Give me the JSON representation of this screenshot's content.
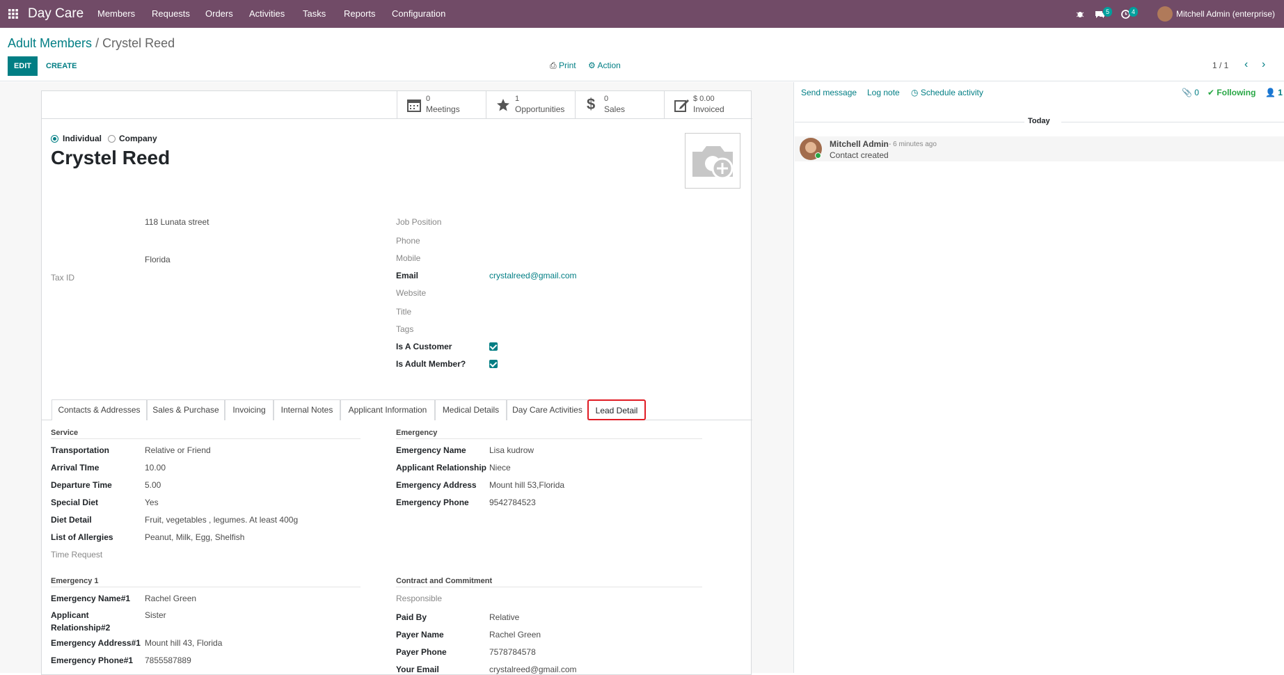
{
  "topbar": {
    "brand": "Day Care",
    "menu": [
      "Members",
      "Requests",
      "Orders",
      "Activities",
      "Tasks",
      "Reports",
      "Configuration"
    ],
    "messages_count": "5",
    "activities_count": "4",
    "user": "Mitchell Admin (enterprise)"
  },
  "control": {
    "breadcrumb_parent": "Adult Members",
    "breadcrumb_sep": "/",
    "breadcrumb_current": "Crystel Reed",
    "edit_label": "EDIT",
    "create_label": "CREATE",
    "print_label": "Print",
    "action_label": "Action",
    "pager": "1 / 1"
  },
  "smart_buttons": [
    {
      "icon": "calendar-icon",
      "number": "0",
      "label": "Meetings"
    },
    {
      "icon": "star-icon",
      "number": "1",
      "label": "Opportunities"
    },
    {
      "icon": "dollar-icon",
      "number": "0",
      "label": "Sales"
    },
    {
      "icon": "edit-icon",
      "number": "$ 0.00",
      "label": "Invoiced"
    }
  ],
  "form": {
    "type_individual": "Individual",
    "type_company": "Company",
    "name": "Crystel Reed",
    "street": "118 Lunata street",
    "state": "Florida",
    "tax_id_label": "Tax ID",
    "job_position_label": "Job Position",
    "phone_label": "Phone",
    "mobile_label": "Mobile",
    "email_label": "Email",
    "email_value": "crystalreed@gmail.com",
    "website_label": "Website",
    "title_label": "Title",
    "tags_label": "Tags",
    "is_customer_label": "Is A Customer",
    "is_adult_label": "Is Adult Member?"
  },
  "tabs": [
    "Contacts & Addresses",
    "Sales & Purchase",
    "Invoicing",
    "Internal Notes",
    "Applicant Information",
    "Medical Details",
    "Day Care Activities",
    "Lead Detail"
  ],
  "lead": {
    "service_title": "Service",
    "service": [
      {
        "label": "Transportation",
        "value": "Relative or Friend"
      },
      {
        "label": "Arrival TIme",
        "value": "10.00"
      },
      {
        "label": "Departure Time",
        "value": "5.00"
      },
      {
        "label": "Special Diet",
        "value": "Yes"
      },
      {
        "label": "Diet Detail",
        "value": "Fruit, vegetables , legumes. At least 400g"
      },
      {
        "label": "List of Allergies",
        "value": "Peanut, Milk, Egg, Shelfish"
      }
    ],
    "time_request_label": "Time Request",
    "emergency_title": "Emergency",
    "emergency": [
      {
        "label": "Emergency Name",
        "value": "Lisa kudrow"
      },
      {
        "label": "Applicant Relationship",
        "value": "Niece"
      },
      {
        "label": "Emergency Address",
        "value": "Mount hill 53,Florida"
      },
      {
        "label": "Emergency Phone",
        "value": "9542784523"
      }
    ],
    "emergency1_title": "Emergency 1",
    "emergency1_name_label": "Emergency Name#1",
    "emergency1_name": "Rachel Green",
    "emergency1_rel_label_1": "Applicant",
    "emergency1_rel_label_2": "Relationship#2",
    "emergency1_rel": "Sister",
    "emergency1_addr_label": "Emergency Address#1",
    "emergency1_addr": "Mount hill 43, Florida",
    "emergency1_phone_label": "Emergency Phone#1",
    "emergency1_phone": "7855587889",
    "contract_title": "Contract and Commitment",
    "responsible_label": "Responsible",
    "contract": [
      {
        "label": "Paid By",
        "value": "Relative"
      },
      {
        "label": "Payer Name",
        "value": "Rachel Green"
      },
      {
        "label": "Payer Phone",
        "value": "7578784578"
      },
      {
        "label": "Your Email",
        "value": "crystalreed@gmail.com"
      }
    ]
  },
  "chatter": {
    "send_message": "Send message",
    "log_note": "Log note",
    "schedule_activity": "Schedule activity",
    "attachments": "0",
    "following": "Following",
    "followers": "1",
    "date_sep": "Today",
    "author": "Mitchell Admin",
    "time": "- 6 minutes ago",
    "body": "Contact created"
  },
  "colors": {
    "topbar": "#714b67",
    "accent": "#017e84",
    "badge": "#00a09d",
    "active_tab_border": "#e01b24",
    "following": "#28a745"
  }
}
